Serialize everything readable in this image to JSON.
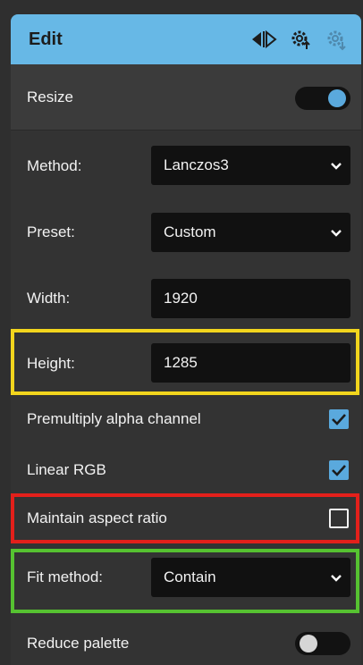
{
  "header": {
    "title": "Edit",
    "icons": [
      "split-view-icon",
      "settings-export-icon",
      "settings-import-icon"
    ]
  },
  "resize": {
    "label": "Resize",
    "enabled": true
  },
  "method": {
    "label": "Method:",
    "value": "Lanczos3"
  },
  "preset": {
    "label": "Preset:",
    "value": "Custom"
  },
  "width": {
    "label": "Width:",
    "value": "1920"
  },
  "height": {
    "label": "Height:",
    "value": "1285"
  },
  "premultiply": {
    "label": "Premultiply alpha channel",
    "checked": true
  },
  "linear_rgb": {
    "label": "Linear RGB",
    "checked": true
  },
  "aspect": {
    "label": "Maintain aspect ratio",
    "checked": false
  },
  "fit": {
    "label": "Fit method:",
    "value": "Contain"
  },
  "palette": {
    "label": "Reduce palette",
    "enabled": false
  },
  "colors": {
    "header_bg": "#67b8e6",
    "accent": "#5aa9dd",
    "highlight_height": "#f2d51d",
    "highlight_aspect": "#e3201b",
    "highlight_fit": "#56c231"
  }
}
